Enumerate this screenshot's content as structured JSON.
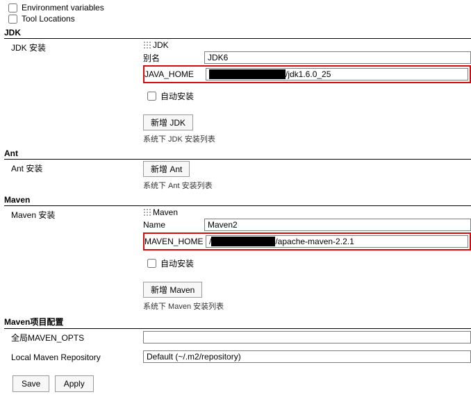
{
  "top_checkboxes": {
    "env_vars": "Environment variables",
    "tool_locations": "Tool Locations"
  },
  "jdk": {
    "header": "JDK",
    "install_label": "JDK 安装",
    "tool_name": "JDK",
    "alias_label": "别名",
    "alias_value": "JDK6",
    "home_label": "JAVA_HOME",
    "home_suffix": "/jdk1.6.0_25",
    "auto_install_label": "自动安装",
    "add_button": "新增 JDK",
    "list_note": "系统下 JDK 安装列表"
  },
  "ant": {
    "header": "Ant",
    "install_label": "Ant 安装",
    "add_button": "新增 Ant",
    "list_note": "系统下 Ant 安装列表"
  },
  "maven": {
    "header": "Maven",
    "install_label": "Maven 安装",
    "tool_name": "Maven",
    "name_label": "Name",
    "name_value": "Maven2",
    "home_label": "MAVEN_HOME",
    "home_suffix": "/apache-maven-2.2.1",
    "auto_install_label": "自动安装",
    "add_button": "新增 Maven",
    "list_note": "系统下 Maven 安装列表"
  },
  "maven_config": {
    "header": "Maven项目配置",
    "global_opts_label": "全局MAVEN_OPTS",
    "global_opts_value": "",
    "local_repo_label": "Local Maven Repository",
    "local_repo_value": "Default (~/.m2/repository)"
  },
  "buttons": {
    "save": "Save",
    "apply": "Apply"
  }
}
